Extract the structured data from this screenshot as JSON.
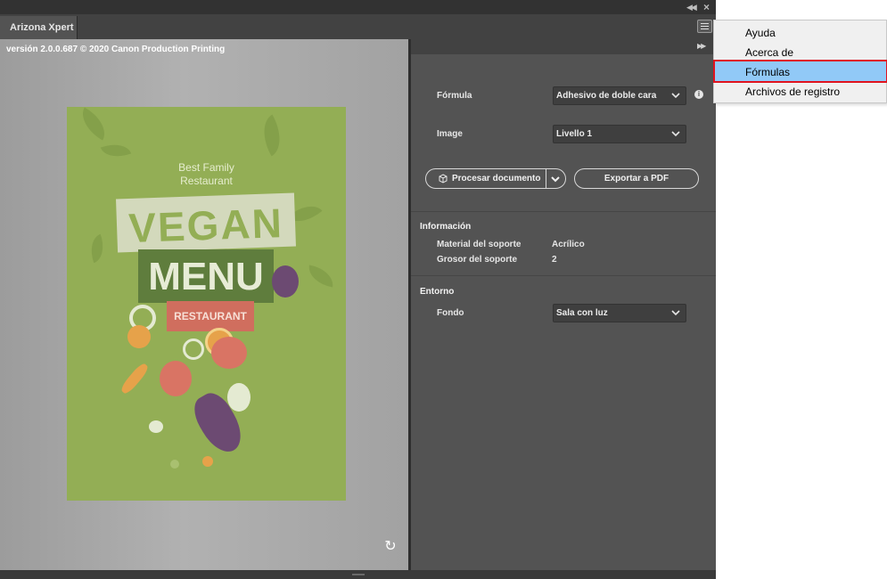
{
  "app": {
    "tab_title": "Arizona Xpert",
    "version_text": "versión 2.0.0.687 © 2020 Canon Production Printing"
  },
  "preview": {
    "poster": {
      "subtitle_line1": "Best Family",
      "subtitle_line2": "Restaurant",
      "headline1": "VEGAN",
      "headline2": "MENU",
      "badge": "RESTAURANT"
    }
  },
  "settings": {
    "formula_label": "Fórmula",
    "formula_value": "Adhesivo de doble cara",
    "image_label": "Image",
    "image_value": "Livello 1",
    "process_button": "Procesar documento",
    "export_button": "Exportar a PDF",
    "info_section": "Información",
    "info_rows": [
      {
        "label": "Material del soporte",
        "value": "Acrílico"
      },
      {
        "label": "Grosor del soporte",
        "value": "2"
      }
    ],
    "environment_section": "Entorno",
    "background_label": "Fondo",
    "background_value": "Sala con luz"
  },
  "popup_menu": {
    "items": [
      {
        "label": "Ayuda",
        "selected": false
      },
      {
        "label": "Acerca de",
        "selected": false
      },
      {
        "label": "Fórmulas",
        "selected": true
      },
      {
        "label": "Archivos de registro",
        "selected": false
      }
    ]
  },
  "icons": {
    "info": "i",
    "rotate": "↻"
  },
  "colors": {
    "panel_bg": "#535353",
    "menu_highlight": "#91c9f7",
    "highlight_outline": "#e0131f",
    "poster_green": "#93ae55"
  }
}
